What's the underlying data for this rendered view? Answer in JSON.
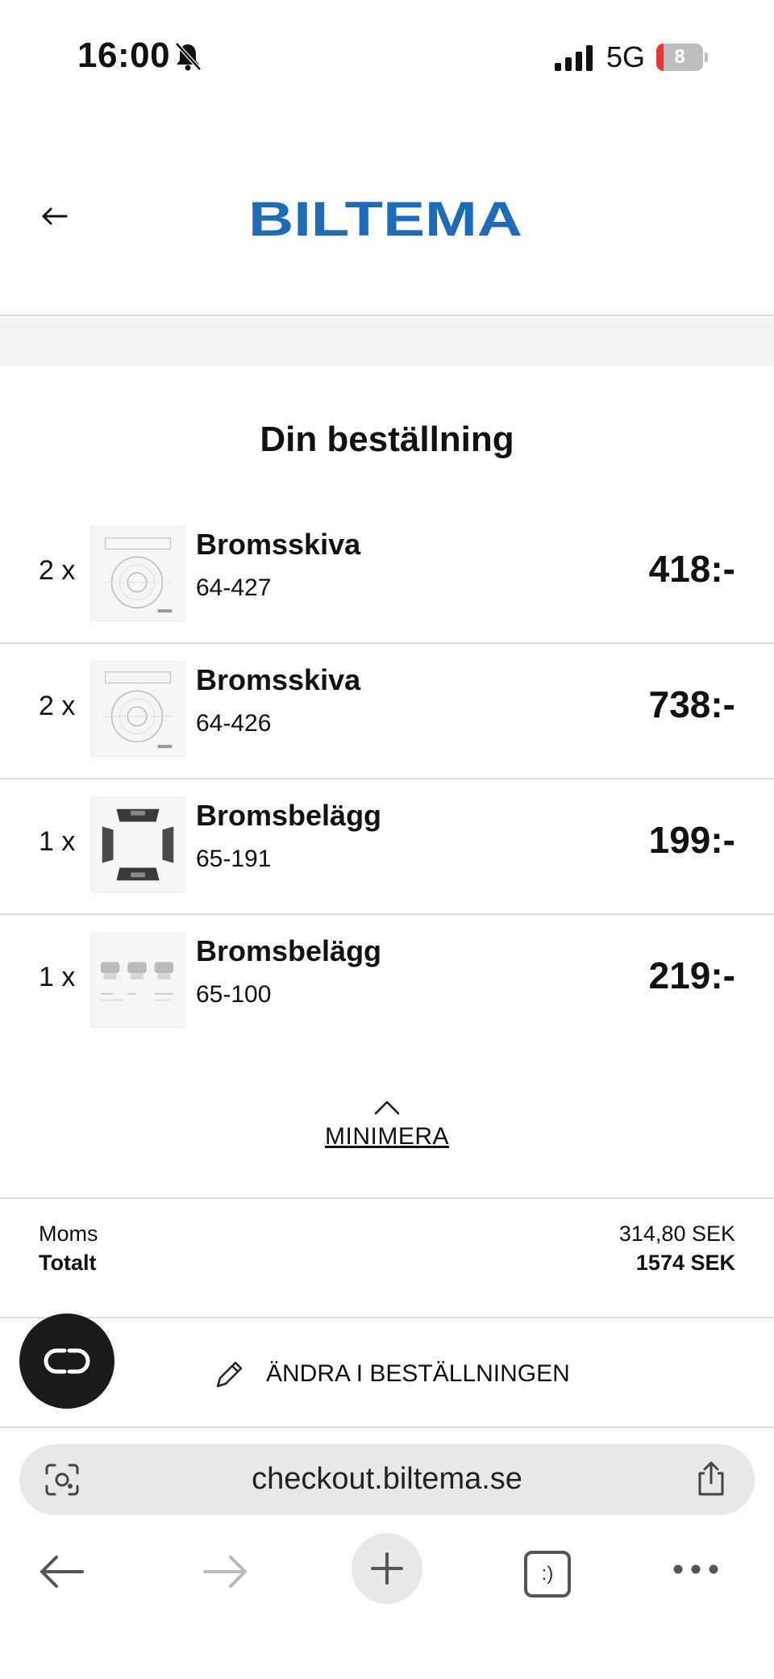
{
  "status_bar": {
    "time": "16:00",
    "network": "5G",
    "battery_level": "8",
    "battery_fraction": 0.15
  },
  "header": {
    "logo_text": "BILTEMA",
    "brand_color": "#1e6bb8"
  },
  "order": {
    "title": "Din beställning",
    "items": [
      {
        "qty": "2 x",
        "name": "Bromsskiva",
        "code": "64-427",
        "price": "418:-",
        "thumb": "brake-disc-drawing"
      },
      {
        "qty": "2 x",
        "name": "Bromsskiva",
        "code": "64-426",
        "price": "738:-",
        "thumb": "brake-disc-drawing"
      },
      {
        "qty": "1 x",
        "name": "Bromsbelägg",
        "code": "65-191",
        "price": "199:-",
        "thumb": "brake-pads-photo"
      },
      {
        "qty": "1 x",
        "name": "Bromsbelägg",
        "code": "65-100",
        "price": "219:-",
        "thumb": "brake-pads-drawing"
      }
    ],
    "minimize_label": "MINIMERA"
  },
  "totals": {
    "tax_label": "Moms",
    "tax_value": "314,80 SEK",
    "total_label": "Totalt",
    "total_value": "1574 SEK"
  },
  "edit_order_label": "ÄNDRA I BESTÄLLNINGEN",
  "browser": {
    "url": "checkout.biltema.se",
    "tabs_glyph": ":)"
  }
}
